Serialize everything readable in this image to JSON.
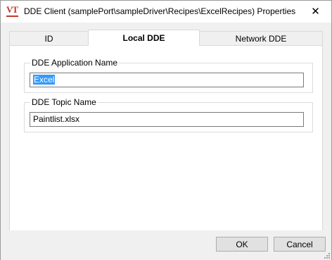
{
  "window": {
    "title": "DDE Client (samplePort\\sampleDriver\\Recipes\\ExcelRecipes) Properties",
    "icon_text": "VT",
    "close_glyph": "✕"
  },
  "tabs": [
    {
      "label": "ID",
      "active": false
    },
    {
      "label": "Local DDE",
      "active": true
    },
    {
      "label": "Network DDE",
      "active": false
    }
  ],
  "local_dde": {
    "application_group_label": "DDE Application Name",
    "application_value": "Excel",
    "application_selected": true,
    "topic_group_label": "DDE Topic Name",
    "topic_value": "Paintlist.xlsx"
  },
  "buttons": {
    "ok_label": "OK",
    "cancel_label": "Cancel"
  },
  "colors": {
    "selection": "#3399ff",
    "icon_accent": "#c0392b"
  }
}
